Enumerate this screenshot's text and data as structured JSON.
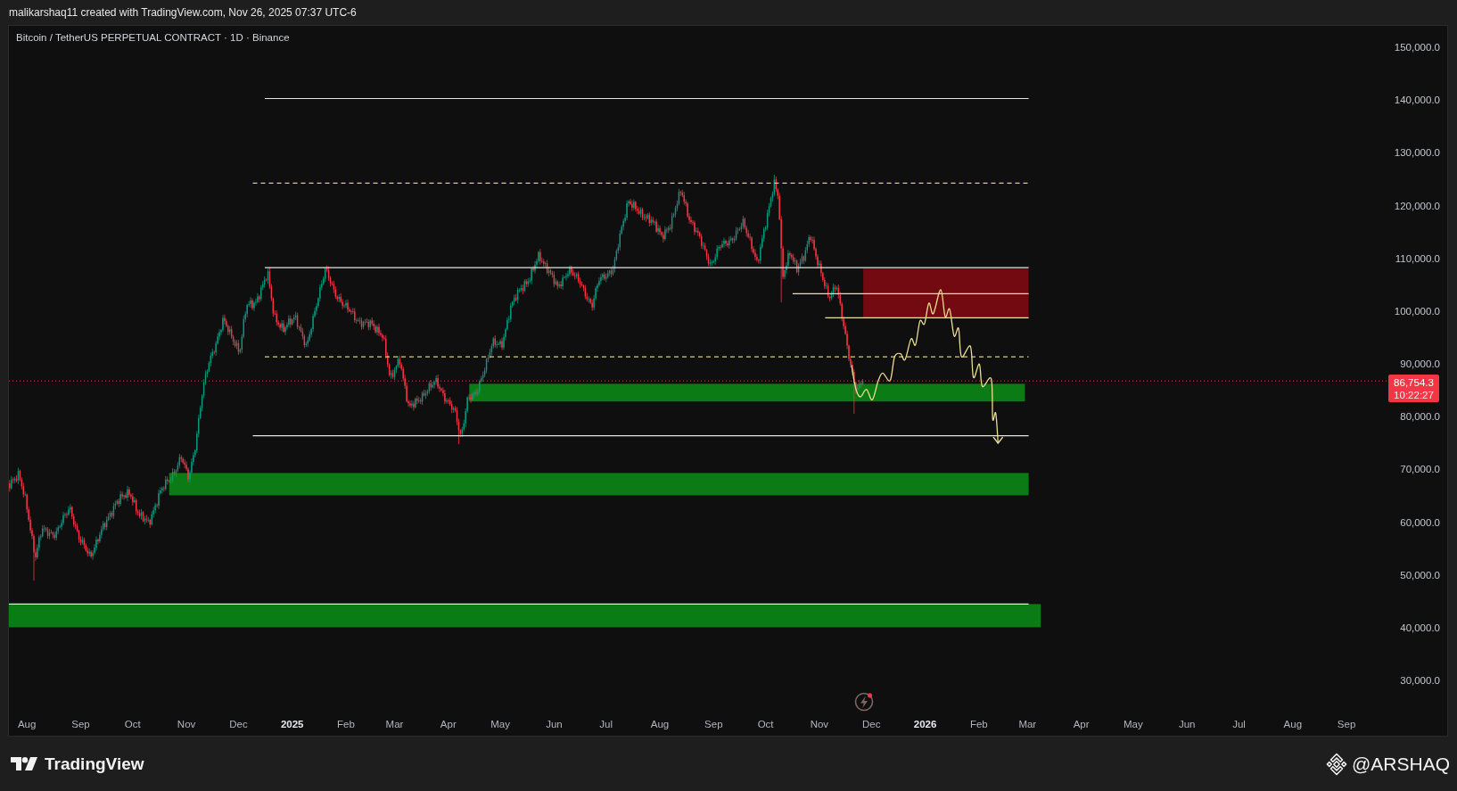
{
  "header": {
    "caption": "malikarshaq11 created with TradingView.com, Nov 26, 2025 07:37 UTC-6"
  },
  "chart": {
    "title": "Bitcoin / TetherUS PERPETUAL CONTRACT · 1D · Binance",
    "price_axis": {
      "labels": [
        "150,000.0",
        "140,000.0",
        "130,000.0",
        "120,000.0",
        "110,000.0",
        "100,000.0",
        "90,000.0",
        "80,000.0",
        "70,000.0",
        "60,000.0",
        "50,000.0",
        "40,000.0",
        "30,000.0"
      ]
    },
    "current_price": {
      "price": "86,754.3",
      "countdown": "10:22:27"
    },
    "time_axis": {
      "ticks": [
        {
          "label": "Aug",
          "kind": "month"
        },
        {
          "label": "Sep",
          "kind": "month"
        },
        {
          "label": "Oct",
          "kind": "month"
        },
        {
          "label": "Nov",
          "kind": "month"
        },
        {
          "label": "Dec",
          "kind": "month"
        },
        {
          "label": "2025",
          "kind": "year"
        },
        {
          "label": "Feb",
          "kind": "month"
        },
        {
          "label": "Mar",
          "kind": "month"
        },
        {
          "label": "Apr",
          "kind": "month"
        },
        {
          "label": "May",
          "kind": "month"
        },
        {
          "label": "Jun",
          "kind": "month"
        },
        {
          "label": "Jul",
          "kind": "month"
        },
        {
          "label": "Aug",
          "kind": "month"
        },
        {
          "label": "Sep",
          "kind": "month"
        },
        {
          "label": "Oct",
          "kind": "month"
        },
        {
          "label": "Nov",
          "kind": "month"
        },
        {
          "label": "Dec",
          "kind": "month"
        },
        {
          "label": "2026",
          "kind": "year"
        },
        {
          "label": "Feb",
          "kind": "month"
        },
        {
          "label": "Mar",
          "kind": "month"
        },
        {
          "label": "Apr",
          "kind": "month"
        },
        {
          "label": "May",
          "kind": "month"
        },
        {
          "label": "Jun",
          "kind": "month"
        },
        {
          "label": "Jul",
          "kind": "month"
        },
        {
          "label": "Aug",
          "kind": "month"
        },
        {
          "label": "Sep",
          "kind": "month"
        }
      ]
    }
  },
  "footer": {
    "brand": "TradingView",
    "signature": "@ARSHAQ"
  }
}
